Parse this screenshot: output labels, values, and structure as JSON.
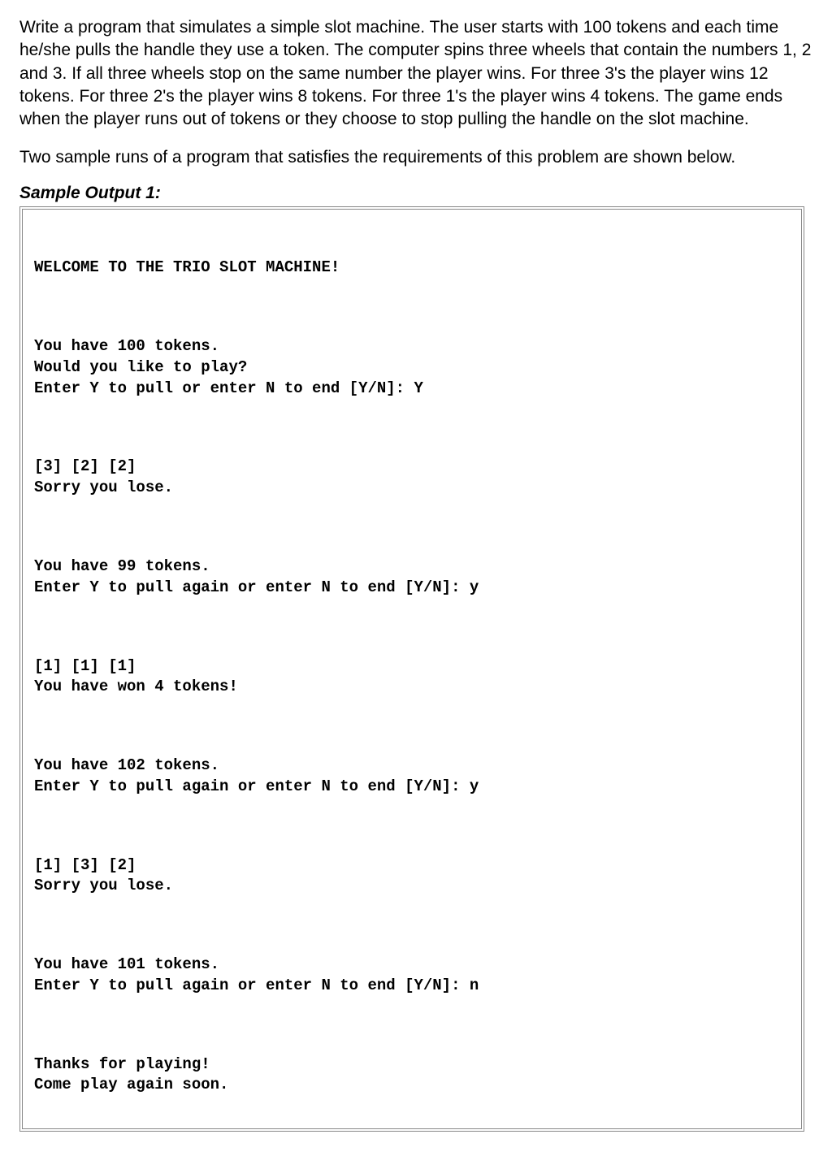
{
  "problem": {
    "para1": "Write a program that simulates a simple slot machine. The user starts with 100 tokens and each time he/she pulls the handle they use a token. The computer spins three wheels that contain the numbers 1, 2 and 3. If all three wheels stop on the same number the player wins. For three 3's the player wins 12 tokens. For three 2's the player wins 8 tokens. For three 1's the player wins 4 tokens. The game ends when the player runs out of tokens or they choose to stop pulling the handle on the slot machine.",
    "para2": "Two sample runs of a program that satisfies the requirements of this problem are shown below."
  },
  "sample1": {
    "label": "Sample Output 1:",
    "blocks": [
      "WELCOME TO THE TRIO SLOT MACHINE!",
      "You have 100 tokens.\nWould you like to play?\nEnter Y to pull or enter N to end [Y/N]: Y",
      "[3] [2] [2]\nSorry you lose.",
      "You have 99 tokens.\nEnter Y to pull again or enter N to end [Y/N]: y",
      "[1] [1] [1]\nYou have won 4 tokens!",
      "You have 102 tokens.\nEnter Y to pull again or enter N to end [Y/N]: y",
      "[1] [3] [2]\nSorry you lose.",
      "You have 101 tokens.\nEnter Y to pull again or enter N to end [Y/N]: n",
      "Thanks for playing!\nCome play again soon."
    ]
  }
}
